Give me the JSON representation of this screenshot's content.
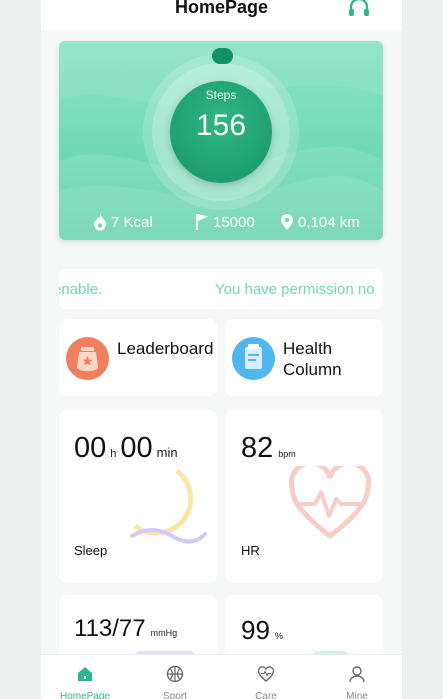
{
  "header": {
    "title": "HomePage",
    "icon": "headset-icon"
  },
  "steps_card": {
    "label": "Steps",
    "value": "156",
    "calories": "7 Kcal",
    "goal": "15000",
    "distance": "0,104 km",
    "accent": "#6fd8b4"
  },
  "marquee": {
    "left_text": "enable.",
    "right_text": "You have permission no"
  },
  "features": [
    {
      "label": "Leaderboard",
      "icon": "medal-icon"
    },
    {
      "label": "Health Column",
      "icon": "document-icon"
    }
  ],
  "sleep": {
    "hours": "00",
    "h_unit": "h",
    "minutes": "00",
    "min_unit": "min",
    "title": "Sleep"
  },
  "hr": {
    "value": "82",
    "unit": "bpm",
    "title": "HR"
  },
  "bp": {
    "value": "113/77",
    "unit": "mmHg"
  },
  "spo2": {
    "value": "99",
    "unit": "%"
  },
  "nav": [
    {
      "label": "HomePage",
      "icon": "home-icon",
      "active": true
    },
    {
      "label": "Sport",
      "icon": "basketball-icon",
      "active": false
    },
    {
      "label": "Care",
      "icon": "heart-icon",
      "active": false
    },
    {
      "label": "Mine",
      "icon": "user-icon",
      "active": false
    }
  ]
}
